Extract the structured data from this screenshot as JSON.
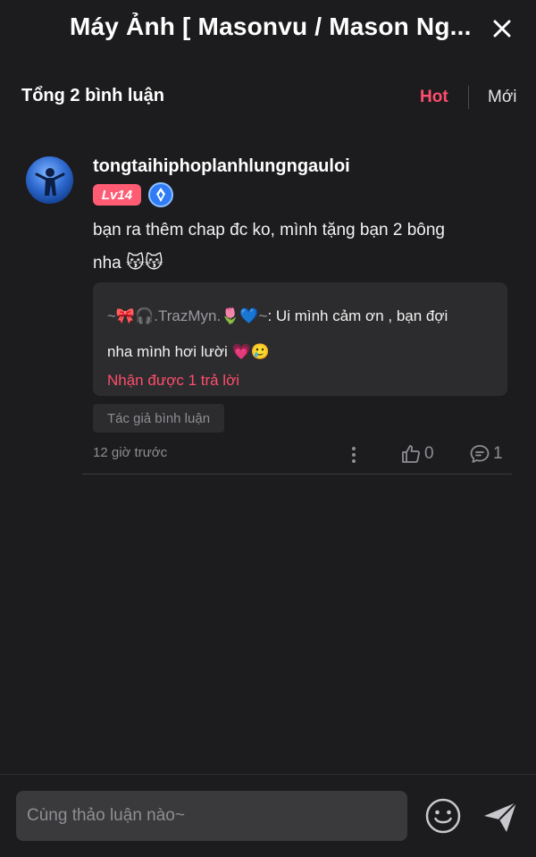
{
  "header": {
    "title": "Máy Ảnh [ Masonvu / Mason Ng...",
    "close_icon": "close-icon"
  },
  "sort": {
    "total_label": "Tổng 2 bình luận",
    "tab_hot": "Hot",
    "tab_new": "Mới",
    "active_tab_color": "#ff4d6d"
  },
  "comment": {
    "username": "tongtaihiphoplanhlungngauloi",
    "level": "Lv14",
    "level_color": "#ff5c74",
    "text_line1": "bạn ra thêm chap đc ko, mình tặng bạn 2 bông",
    "text_line2": "nha",
    "text_emojis": "😽😽",
    "reply": {
      "author": "~🎀🎧.TrazMyn.🌷💙~",
      "text_line1": ": Ui mình cảm ơn , bạn đợi",
      "text_line2": "nha mình hơi lười",
      "text_emojis": "💗🥲",
      "count_label": "Nhận được 1 trả lời"
    },
    "author_tag": "Tác giả bình luận",
    "time": "12 giờ trước",
    "likes": "0",
    "replies": "1"
  },
  "composer": {
    "placeholder": "Cùng thảo luận nào~"
  }
}
